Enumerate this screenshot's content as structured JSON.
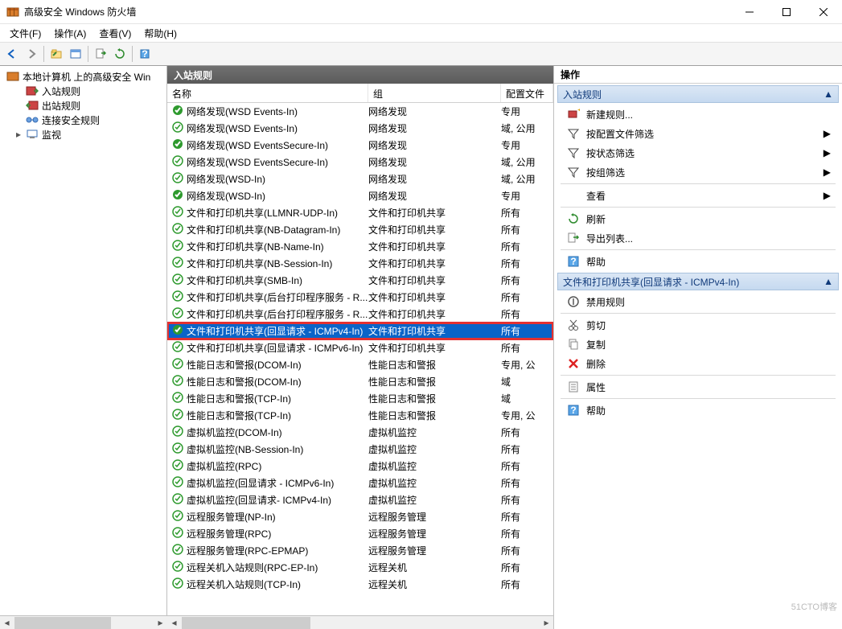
{
  "window": {
    "title": "高级安全 Windows 防火墙"
  },
  "menu": {
    "file": "文件(F)",
    "action": "操作(A)",
    "view": "查看(V)",
    "help": "帮助(H)"
  },
  "tree": {
    "root": "本地计算机 上的高级安全 Win",
    "inbound": "入站规则",
    "outbound": "出站规则",
    "connection": "连接安全规则",
    "monitor": "监视"
  },
  "mid": {
    "header": "入站规则",
    "cols": {
      "name": "名称",
      "group": "组",
      "profile": "配置文件"
    },
    "rows": [
      {
        "on": true,
        "name": "网络发现(WSD Events-In)",
        "group": "网络发现",
        "profile": "专用"
      },
      {
        "on": false,
        "name": "网络发现(WSD Events-In)",
        "group": "网络发现",
        "profile": "域, 公用"
      },
      {
        "on": true,
        "name": "网络发现(WSD EventsSecure-In)",
        "group": "网络发现",
        "profile": "专用"
      },
      {
        "on": false,
        "name": "网络发现(WSD EventsSecure-In)",
        "group": "网络发现",
        "profile": "域, 公用"
      },
      {
        "on": false,
        "name": "网络发现(WSD-In)",
        "group": "网络发现",
        "profile": "域, 公用"
      },
      {
        "on": true,
        "name": "网络发现(WSD-In)",
        "group": "网络发现",
        "profile": "专用"
      },
      {
        "on": false,
        "name": "文件和打印机共享(LLMNR-UDP-In)",
        "group": "文件和打印机共享",
        "profile": "所有"
      },
      {
        "on": false,
        "name": "文件和打印机共享(NB-Datagram-In)",
        "group": "文件和打印机共享",
        "profile": "所有"
      },
      {
        "on": false,
        "name": "文件和打印机共享(NB-Name-In)",
        "group": "文件和打印机共享",
        "profile": "所有"
      },
      {
        "on": false,
        "name": "文件和打印机共享(NB-Session-In)",
        "group": "文件和打印机共享",
        "profile": "所有"
      },
      {
        "on": false,
        "name": "文件和打印机共享(SMB-In)",
        "group": "文件和打印机共享",
        "profile": "所有"
      },
      {
        "on": false,
        "name": "文件和打印机共享(后台打印程序服务 - R...",
        "group": "文件和打印机共享",
        "profile": "所有"
      },
      {
        "on": false,
        "name": "文件和打印机共享(后台打印程序服务 - R...",
        "group": "文件和打印机共享",
        "profile": "所有"
      },
      {
        "on": true,
        "sel": true,
        "hl": true,
        "name": "文件和打印机共享(回显请求 - ICMPv4-In)",
        "group": "文件和打印机共享",
        "profile": "所有"
      },
      {
        "on": false,
        "name": "文件和打印机共享(回显请求 - ICMPv6-In)",
        "group": "文件和打印机共享",
        "profile": "所有"
      },
      {
        "on": false,
        "name": "性能日志和警报(DCOM-In)",
        "group": "性能日志和警报",
        "profile": "专用, 公"
      },
      {
        "on": false,
        "name": "性能日志和警报(DCOM-In)",
        "group": "性能日志和警报",
        "profile": "域"
      },
      {
        "on": false,
        "name": "性能日志和警报(TCP-In)",
        "group": "性能日志和警报",
        "profile": "域"
      },
      {
        "on": false,
        "name": "性能日志和警报(TCP-In)",
        "group": "性能日志和警报",
        "profile": "专用, 公"
      },
      {
        "on": false,
        "name": "虚拟机监控(DCOM-In)",
        "group": "虚拟机监控",
        "profile": "所有"
      },
      {
        "on": false,
        "name": "虚拟机监控(NB-Session-In)",
        "group": "虚拟机监控",
        "profile": "所有"
      },
      {
        "on": false,
        "name": "虚拟机监控(RPC)",
        "group": "虚拟机监控",
        "profile": "所有"
      },
      {
        "on": false,
        "name": "虚拟机监控(回显请求 - ICMPv6-In)",
        "group": "虚拟机监控",
        "profile": "所有"
      },
      {
        "on": false,
        "name": "虚拟机监控(回显请求- ICMPv4-In)",
        "group": "虚拟机监控",
        "profile": "所有"
      },
      {
        "on": false,
        "name": "远程服务管理(NP-In)",
        "group": "远程服务管理",
        "profile": "所有"
      },
      {
        "on": false,
        "name": "远程服务管理(RPC)",
        "group": "远程服务管理",
        "profile": "所有"
      },
      {
        "on": false,
        "name": "远程服务管理(RPC-EPMAP)",
        "group": "远程服务管理",
        "profile": "所有"
      },
      {
        "on": false,
        "name": "远程关机入站规则(RPC-EP-In)",
        "group": "远程关机",
        "profile": "所有"
      },
      {
        "on": false,
        "name": "远程关机入站规则(TCP-In)",
        "group": "远程关机",
        "profile": "所有"
      }
    ]
  },
  "actions": {
    "header": "操作",
    "group1": "入站规则",
    "new_rule": "新建规则...",
    "filter_profile": "按配置文件筛选",
    "filter_state": "按状态筛选",
    "filter_group": "按组筛选",
    "view": "查看",
    "refresh": "刷新",
    "export": "导出列表...",
    "help": "帮助",
    "group2": "文件和打印机共享(回显请求 - ICMPv4-In)",
    "disable": "禁用规则",
    "cut": "剪切",
    "copy": "复制",
    "delete": "删除",
    "properties": "属性",
    "help2": "帮助"
  },
  "watermark": "51CTO博客"
}
